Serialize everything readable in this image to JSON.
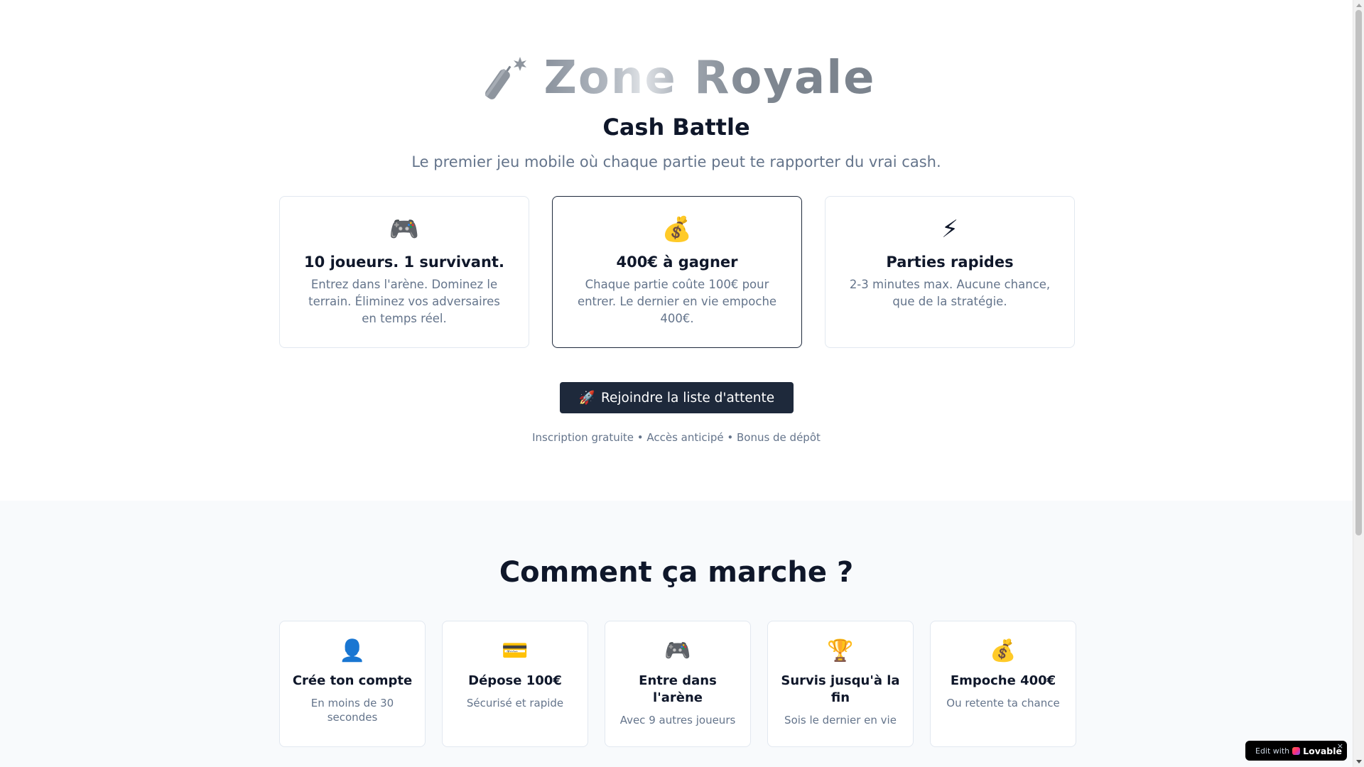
{
  "hero": {
    "brand": "Zone Royale",
    "logo_icon": "firework-rocket-icon",
    "subtitle": "Cash Battle",
    "tagline": "Le premier jeu mobile où chaque partie peut te rapporter du vrai cash.",
    "features": [
      {
        "icon": "🎮",
        "icon_name": "game-controller-icon",
        "title": "10 joueurs. 1 survivant.",
        "desc": "Entrez dans l'arène. Dominez le terrain. Éliminez vos adversaires en temps réel."
      },
      {
        "icon": "💰",
        "icon_name": "money-bag-icon",
        "title": "400€ à gagner",
        "desc": "Chaque partie coûte 100€ pour entrer. Le dernier en vie empoche 400€."
      },
      {
        "icon": "⚡",
        "icon_name": "lightning-icon",
        "title": "Parties rapides",
        "desc": "2-3 minutes max. Aucune chance, que de la stratégie."
      }
    ],
    "cta_icon": "🚀",
    "cta_label": "Rejoindre la liste d'attente",
    "perks": "Inscription gratuite • Accès anticipé • Bonus de dépôt"
  },
  "how": {
    "title": "Comment ça marche ?",
    "steps": [
      {
        "icon": "👤",
        "icon_name": "user-icon",
        "title": "Crée ton compte",
        "desc": "En moins de 30 secondes"
      },
      {
        "icon": "💳",
        "icon_name": "credit-card-icon",
        "title": "Dépose 100€",
        "desc": "Sécurisé et rapide"
      },
      {
        "icon": "🎮",
        "icon_name": "game-controller-icon",
        "title": "Entre dans l'arène",
        "desc": "Avec 9 autres joueurs"
      },
      {
        "icon": "🏆",
        "icon_name": "trophy-icon",
        "title": "Survis jusqu'à la fin",
        "desc": "Sois le dernier en vie"
      },
      {
        "icon": "💰",
        "icon_name": "money-bag-icon",
        "title": "Empoche 400€",
        "desc": "Ou retente ta chance"
      }
    ]
  },
  "badge": {
    "edit_with": "Edit with",
    "brand": "Lovable",
    "close": "×"
  },
  "colors": {
    "primary": "#1e293b",
    "muted_text": "#64748b",
    "section_bg": "#f8fafc",
    "border": "#e2e8f0"
  }
}
